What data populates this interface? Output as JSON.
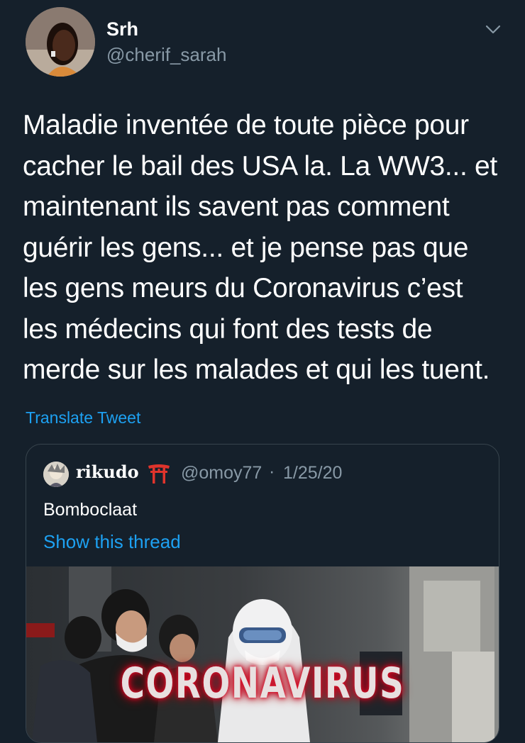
{
  "tweet": {
    "author": {
      "display_name": "Srh",
      "handle": "@cherif_sarah",
      "avatar_icon": "profile-photo"
    },
    "menu_icon": "chevron-down-icon",
    "text_lines": [
      "Maladie inventée de toute pièce pour",
      "cacher le bail des USA la. La WW3... et",
      "maintenant ils savent pas comment",
      "guérir les gens... et je pense pas que",
      "les gens meurs du Coronavirus c’est",
      "les médecins qui font des tests de",
      "merde sur les malades et qui les tuent."
    ],
    "translate_label": "Translate Tweet"
  },
  "quoted": {
    "display_name": "rikudo",
    "name_emoji": "torii-gate-icon",
    "handle": "@omoy77",
    "separator": "·",
    "date": "1/25/20",
    "text": "Bomboclaat",
    "thread_link": "Show this thread",
    "image": {
      "caption": "CORONAVIRUS"
    }
  },
  "colors": {
    "background": "#15202b",
    "primary_text": "#ffffff",
    "secondary_text": "#8899a6",
    "link": "#1da1f2",
    "border": "#38444d"
  }
}
